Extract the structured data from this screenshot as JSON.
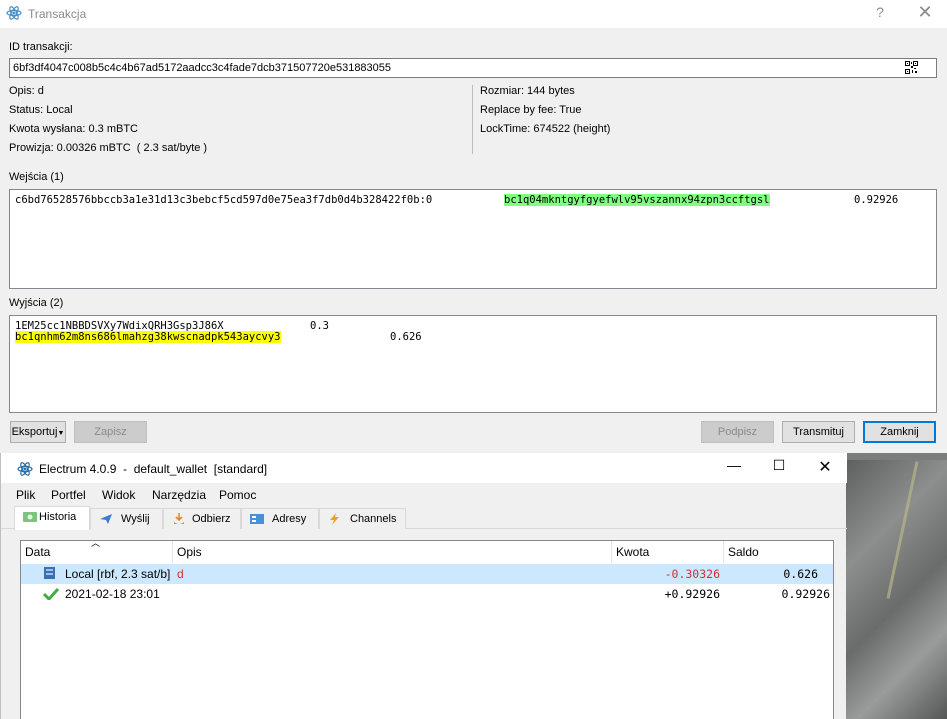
{
  "tx_dialog": {
    "title": "Transakcja",
    "help": "?",
    "close": "✕",
    "txid_label": "ID transakcji:",
    "txid": "6bf3df4047c008b5c4c4b67ad5172aadcc3c4fade7dcb371507720e531883055",
    "description": "Opis: d",
    "status": "Status: Local",
    "amount_sent": "Kwota wysłana: 0.3 mBTC",
    "fee": "Prowizja: 0.00326 mBTC  ( 2.3 sat/byte )",
    "size": "Rozmiar: 144 bytes",
    "rbf": "Replace by fee: True",
    "locktime": "LockTime: 674522 (height)",
    "inputs_label": "Wejścia (1)",
    "inputs": [
      {
        "prevout": "c6bd76528576bbccb3a1e31d13c3bebcf5cd597d0e75ea3f7db0d4b328422f0b:0",
        "address": "bc1q04mkntgyfgyefwlv95vszannx94zpn3ccftgsl",
        "amount": "0.92926"
      }
    ],
    "outputs_label": "Wyjścia (2)",
    "outputs": [
      {
        "address": "1EM25cc1NBBDSVXy7WdixQRH3Gsp3J86X",
        "amount": "0.3"
      },
      {
        "address": "bc1qnhm62m8ns686lmahzg38kwscnadpk543aycvy3",
        "amount": "0.626"
      }
    ],
    "buttons": {
      "export": "Eksportuj",
      "save": "Zapisz",
      "sign": "Podpisz",
      "broadcast": "Transmituj",
      "close": "Zamknij"
    },
    "colors": {
      "input_highlight": "#80ff80",
      "change_highlight": "#ffff00"
    }
  },
  "main_window": {
    "title": "Electrum 4.0.9  -  default_wallet  [standard]",
    "window_buttons": {
      "minimize": "—",
      "maximize": "☐",
      "close": "✕"
    },
    "menu": [
      "Plik",
      "Portfel",
      "Widok",
      "Narzędzia",
      "Pomoc"
    ],
    "tabs": [
      {
        "label": "Historia",
        "icon": "history-icon"
      },
      {
        "label": "Wyślij",
        "icon": "send-icon"
      },
      {
        "label": "Odbierz",
        "icon": "receive-icon"
      },
      {
        "label": "Adresy",
        "icon": "addresses-icon"
      },
      {
        "label": "Channels",
        "icon": "lightning-icon"
      }
    ],
    "history": {
      "columns": [
        "Data",
        "Opis",
        "Kwota",
        "Saldo"
      ],
      "rows": [
        {
          "date": "Local [rbf, 2.3 sat/b]",
          "description": "d",
          "amount": "-0.30326",
          "balance": "0.626",
          "icon": "local-tx-icon"
        },
        {
          "date": "2021-02-18 23:01",
          "description": "",
          "amount": "+0.92926",
          "balance": "0.92926",
          "icon": "confirmed-icon"
        }
      ]
    },
    "colors": {
      "negative_amount": "#cc3333",
      "selection": "#cce8ff"
    }
  }
}
